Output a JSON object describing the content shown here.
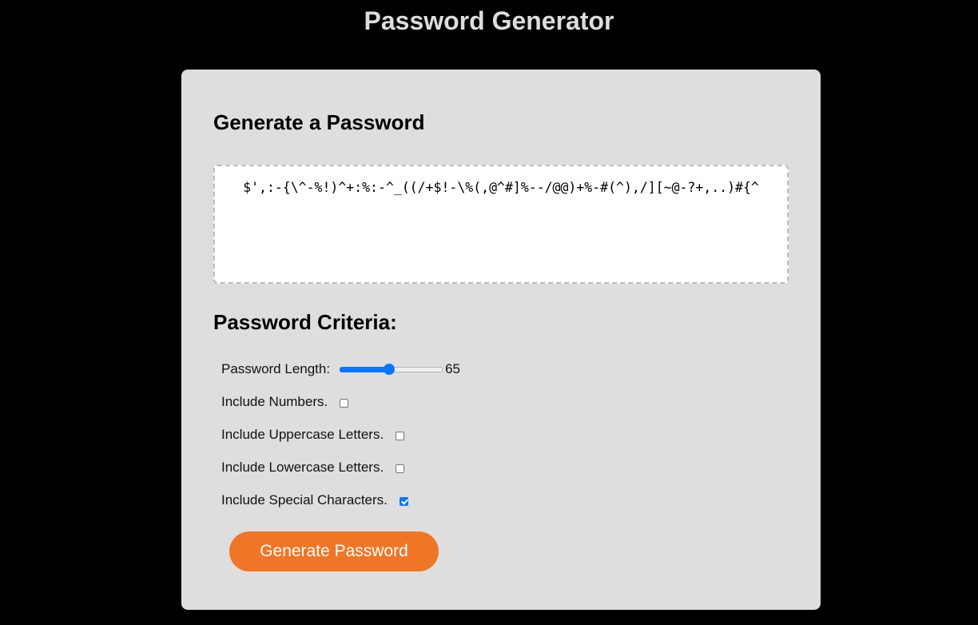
{
  "page": {
    "title": "Password Generator"
  },
  "card": {
    "title": "Generate a Password",
    "password_output": "$',:-{\\^-%!)^+:%:-^_((/+$!-\\%(,@^#]%--/@@)+%-#(^),/][~@-?+,..)#{^"
  },
  "criteria": {
    "title": "Password Criteria:",
    "length_label": "Password Length:",
    "length_value": "65",
    "length_fraction": 0.48,
    "options": [
      {
        "label": "Include Numbers.",
        "checked": false
      },
      {
        "label": "Include Uppercase Letters.",
        "checked": false
      },
      {
        "label": "Include Lowercase Letters.",
        "checked": false
      },
      {
        "label": "Include Special Characters.",
        "checked": true
      }
    ]
  },
  "button": {
    "label": "Generate Password"
  },
  "colors": {
    "background": "#000000",
    "card": "#dedede",
    "accent": "#ef7627",
    "slider": "#0a75ff"
  }
}
